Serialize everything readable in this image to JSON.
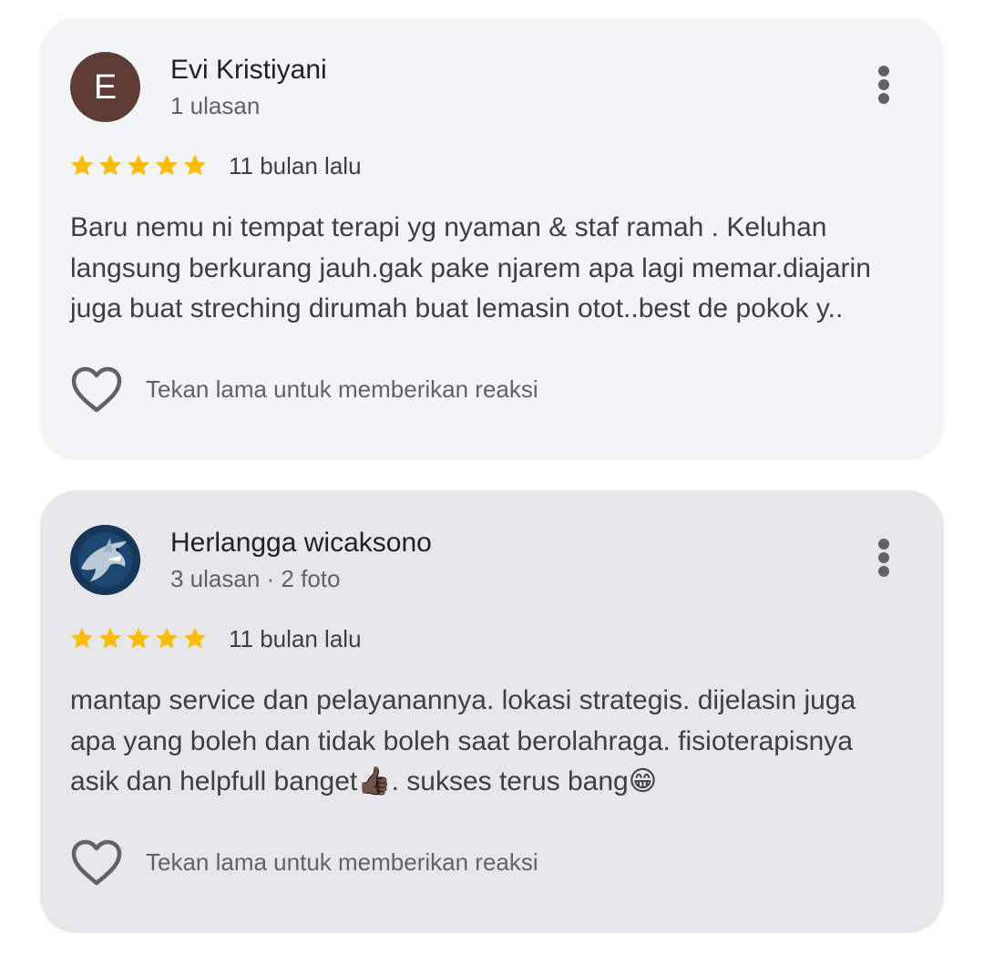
{
  "reviews": [
    {
      "avatar_letter": "E",
      "avatar_color": "#5c3c35",
      "name": "Evi Kristiyani",
      "meta": "1 ulasan",
      "rating": 5,
      "date": "11 bulan lalu",
      "text_lines": [
        "Baru nemu ni tempat terapi yg nyaman & staf ramah . Keluhan",
        "langsung berkurang jauh.gak pake njarem apa lagi memar.diajarin",
        "juga buat streching dirumah buat lemasin otot..best de pokok y.."
      ],
      "reaction_label": "Tekan lama untuk memberikan reaksi"
    },
    {
      "avatar_icon": "shark-avatar",
      "name": "Herlangga wicaksono",
      "meta": "3 ulasan · 2 foto",
      "rating": 5,
      "date": "11 bulan lalu",
      "text_lines": [
        "mantap service dan pelayanannya. lokasi strategis. dijelasin juga",
        "apa yang boleh dan tidak boleh saat berolahraga. fisioterapisnya",
        "asik dan helpfull banget👍🏿. sukses terus bang😁"
      ],
      "reaction_label": "Tekan lama untuk memberikan reaksi"
    }
  ],
  "colors": {
    "card_1_bg": "#f3f4f6",
    "card_2_bg": "#e7e7e9",
    "star": "#fbbc04",
    "icon": "#5f6368"
  }
}
